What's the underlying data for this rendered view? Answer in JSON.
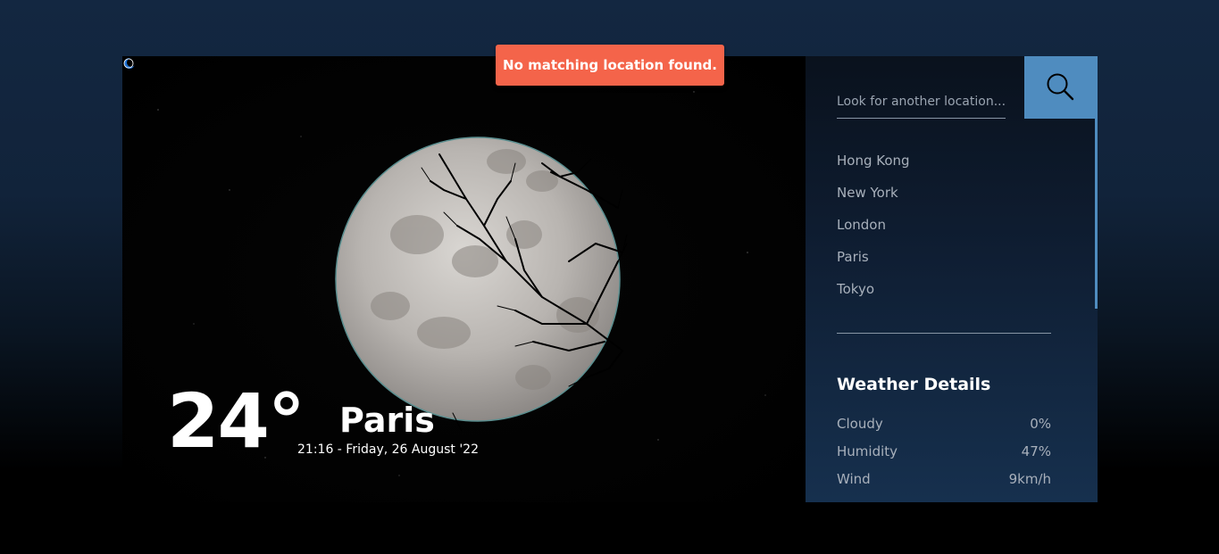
{
  "toast": {
    "message": "No matching location found."
  },
  "weather": {
    "temperature": "24°",
    "city": "Paris",
    "datetime": "21:16 - Friday, 26 August '22",
    "condition_icon": "moon-icon"
  },
  "search": {
    "placeholder": "Look for another location...",
    "button_icon": "search-icon"
  },
  "locations": [
    "Hong Kong",
    "New York",
    "London",
    "Paris",
    "Tokyo"
  ],
  "details": {
    "title": "Weather Details",
    "rows": [
      {
        "label": "Cloudy",
        "value": "0%"
      },
      {
        "label": "Humidity",
        "value": "47%"
      },
      {
        "label": "Wind",
        "value": "9km/h"
      }
    ]
  },
  "colors": {
    "accent": "#4f8cbf",
    "toast": "#f4644a",
    "panel": "#0f1e33"
  }
}
